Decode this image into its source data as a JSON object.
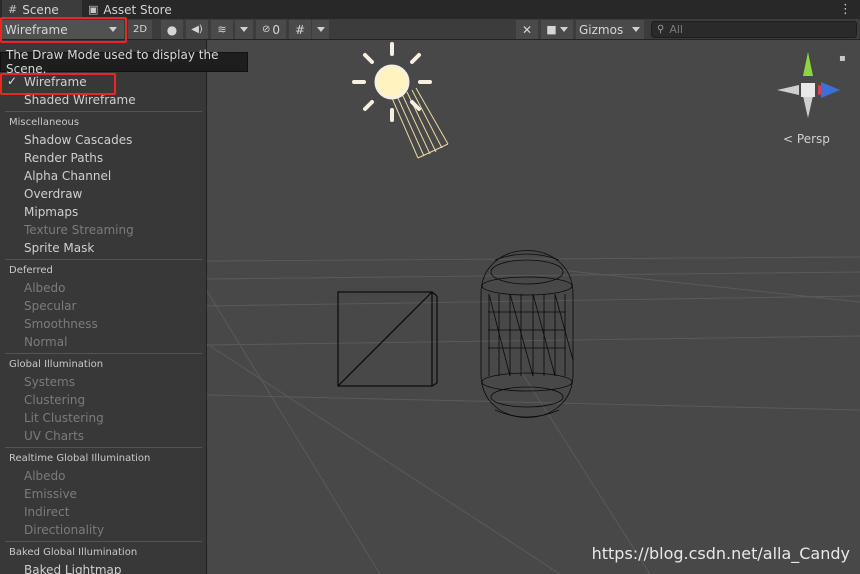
{
  "tabs": [
    {
      "label": "Scene",
      "icon": "grid-icon"
    },
    {
      "label": "Asset Store",
      "icon": "store-icon"
    }
  ],
  "tab_menu_glyph": "⋮",
  "toolbar": {
    "draw_mode": "Wireframe",
    "mode_2d": "2D",
    "hidden_count": "0",
    "gizmos": "Gizmos",
    "search_placeholder": "All"
  },
  "tooltip": "The Draw Mode used to display the Scene.",
  "dropdown": {
    "top_items": [
      {
        "label": "Wireframe",
        "checked": true
      },
      {
        "label": "Shaded Wireframe",
        "checked": false
      }
    ],
    "sections": [
      {
        "header": "Miscellaneous",
        "items": [
          {
            "label": "Shadow Cascades",
            "enabled": true
          },
          {
            "label": "Render Paths",
            "enabled": true
          },
          {
            "label": "Alpha Channel",
            "enabled": true
          },
          {
            "label": "Overdraw",
            "enabled": true
          },
          {
            "label": "Mipmaps",
            "enabled": true
          },
          {
            "label": "Texture Streaming",
            "enabled": false
          },
          {
            "label": "Sprite Mask",
            "enabled": true
          }
        ]
      },
      {
        "header": "Deferred",
        "items": [
          {
            "label": "Albedo",
            "enabled": false
          },
          {
            "label": "Specular",
            "enabled": false
          },
          {
            "label": "Smoothness",
            "enabled": false
          },
          {
            "label": "Normal",
            "enabled": false
          }
        ]
      },
      {
        "header": "Global Illumination",
        "items": [
          {
            "label": "Systems",
            "enabled": false
          },
          {
            "label": "Clustering",
            "enabled": false
          },
          {
            "label": "Lit Clustering",
            "enabled": false
          },
          {
            "label": "UV Charts",
            "enabled": false
          }
        ]
      },
      {
        "header": "Realtime Global Illumination",
        "items": [
          {
            "label": "Albedo",
            "enabled": false
          },
          {
            "label": "Emissive",
            "enabled": false
          },
          {
            "label": "Indirect",
            "enabled": false
          },
          {
            "label": "Directionality",
            "enabled": false
          }
        ]
      },
      {
        "header": "Baked Global Illumination",
        "items": [
          {
            "label": "Baked Lightmap",
            "enabled": true
          }
        ]
      }
    ]
  },
  "viewport": {
    "projection_label": "Persp",
    "gizmo_axes": {
      "y": "#8ed63f",
      "x": "#d8404a",
      "z": "#3e6fd8"
    },
    "watermark": "https://blog.csdn.net/alla_Candy"
  }
}
